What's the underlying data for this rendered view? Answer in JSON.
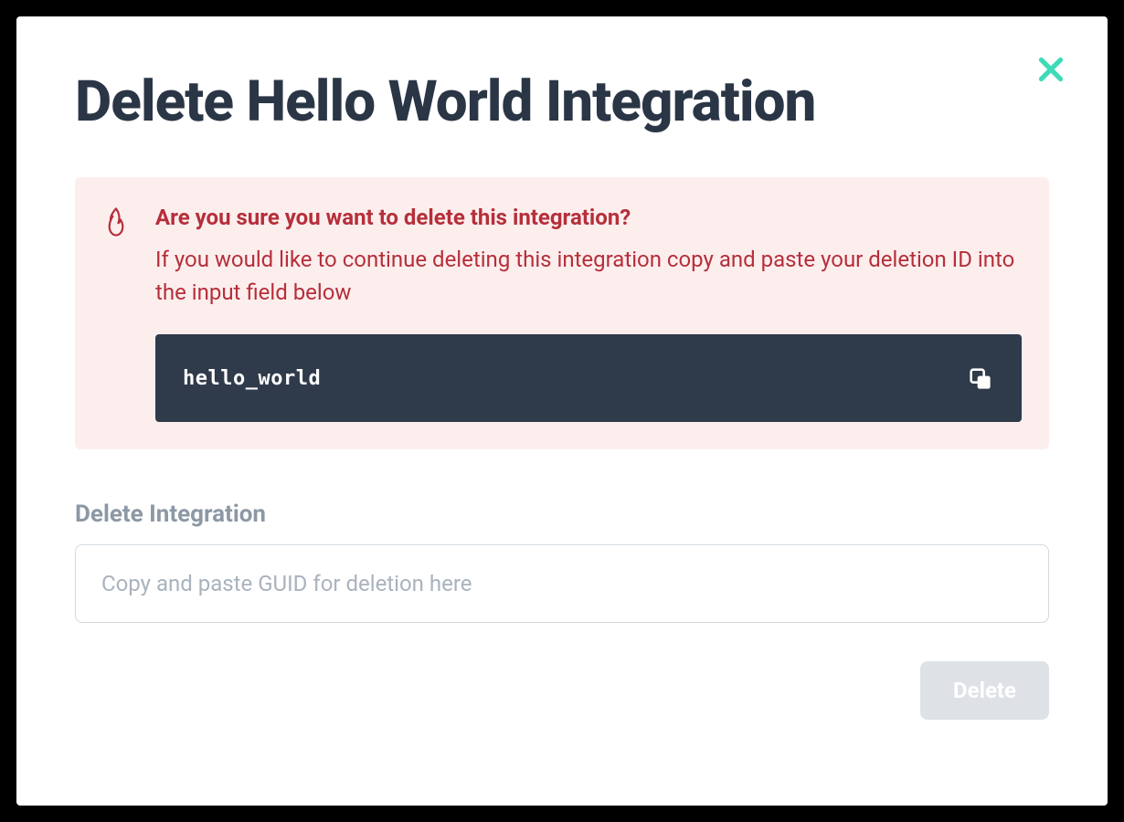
{
  "modal": {
    "title": "Delete Hello World Integration",
    "warning": {
      "heading": "Are you sure you want to delete this integration?",
      "body": "If you would like to continue deleting this integration copy and paste your deletion ID into the input field below",
      "deletion_id": "hello_world"
    },
    "field": {
      "label": "Delete Integration",
      "placeholder": "Copy and paste GUID for deletion here"
    },
    "actions": {
      "delete_label": "Delete"
    }
  },
  "colors": {
    "close_icon": "#3ddbb8",
    "danger": "#b52f3a",
    "danger_bg": "#fdeeee",
    "code_bg": "#2f3a4a",
    "text_dark": "#2a3646",
    "text_muted": "#8d98a5",
    "button_disabled": "#dee2e7"
  }
}
